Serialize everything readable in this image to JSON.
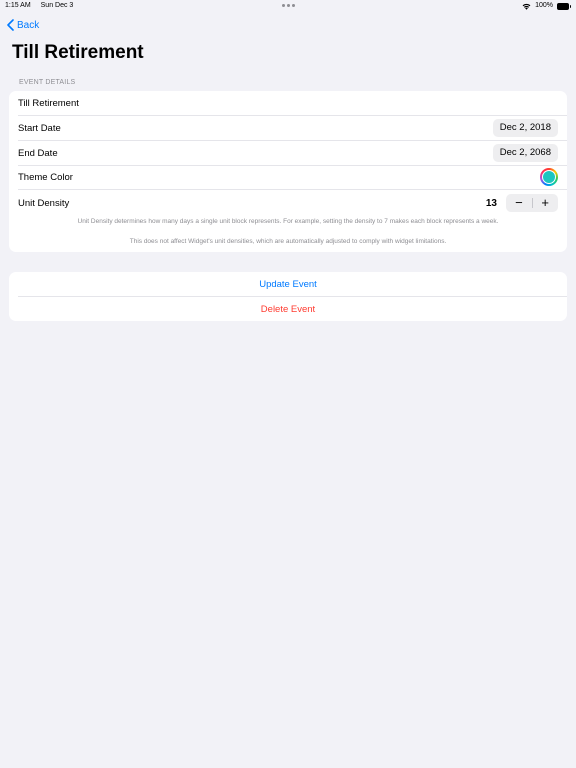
{
  "status_bar": {
    "time": "1:15 AM",
    "date": "Sun Dec 3",
    "battery": "100%"
  },
  "nav": {
    "back_label": "Back",
    "title": "Till Retirement"
  },
  "details": {
    "section_header": "EVENT DETAILS",
    "name_value": "Till Retirement",
    "start_label": "Start Date",
    "start_value": "Dec 2, 2018",
    "end_label": "End Date",
    "end_value": "Dec 2, 2068",
    "theme_label": "Theme Color",
    "theme_color": "#1cc6c0",
    "density_label": "Unit Density",
    "density_value": "13",
    "stepper_minus": "−",
    "stepper_plus": "+",
    "footnote_1": "Unit Density determines how many days a single unit block represents. For example, setting the density to 7 makes each block represents a week.",
    "footnote_2": "This does not affect Widget's unit densities, which are automatically adjusted to comply with widget limitations."
  },
  "actions": {
    "update_label": "Update Event",
    "delete_label": "Delete Event"
  },
  "colors": {
    "accent": "#007aff",
    "destructive": "#ff3b30",
    "background": "#f2f2f7"
  }
}
